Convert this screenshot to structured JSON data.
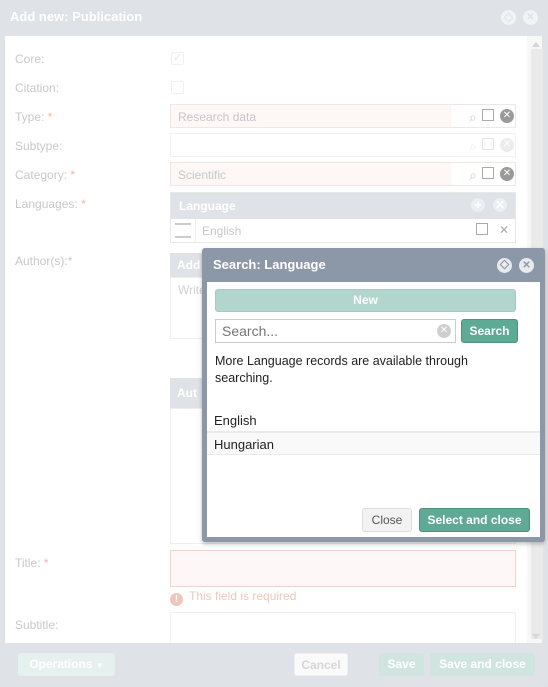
{
  "window": {
    "title": "Add new: Publication"
  },
  "form": {
    "core": {
      "label": "Core:",
      "checked": true
    },
    "citation": {
      "label": "Citation:",
      "checked": false
    },
    "type": {
      "label": "Type:",
      "required_mark": "*",
      "value": "Research data"
    },
    "subtype": {
      "label": "Subtype:",
      "value": ""
    },
    "category": {
      "label": "Category:",
      "required_mark": "*",
      "value": "Scientific"
    },
    "languages": {
      "label": "Languages:",
      "required_mark": "*",
      "header": "Language",
      "items": [
        "English"
      ]
    },
    "authors": {
      "label": "Author(s):",
      "required_mark": "*",
      "add_header": "Add",
      "hint": "Write ... delim... butto...",
      "list_header": "Aut"
    },
    "title": {
      "label": "Title:",
      "required_mark": "*",
      "value": "",
      "error": "This field is required"
    },
    "subtitle": {
      "label": "Subtitle:",
      "value": ""
    }
  },
  "footer": {
    "operations": "Operations",
    "cancel": "Cancel",
    "save": "Save",
    "save_close": "Save and close"
  },
  "dialog": {
    "title": "Search: Language",
    "new_label": "New",
    "search_placeholder": "Search...",
    "search_label": "Search",
    "info": "More Language records are available through searching.",
    "results": [
      "English",
      "Hungarian"
    ],
    "close_label": "Close",
    "select_close_label": "Select and close"
  },
  "icons": {
    "check": "✓",
    "close": "✕",
    "plus": "+",
    "search": "⌕",
    "external": "⇱",
    "warn": "!"
  }
}
